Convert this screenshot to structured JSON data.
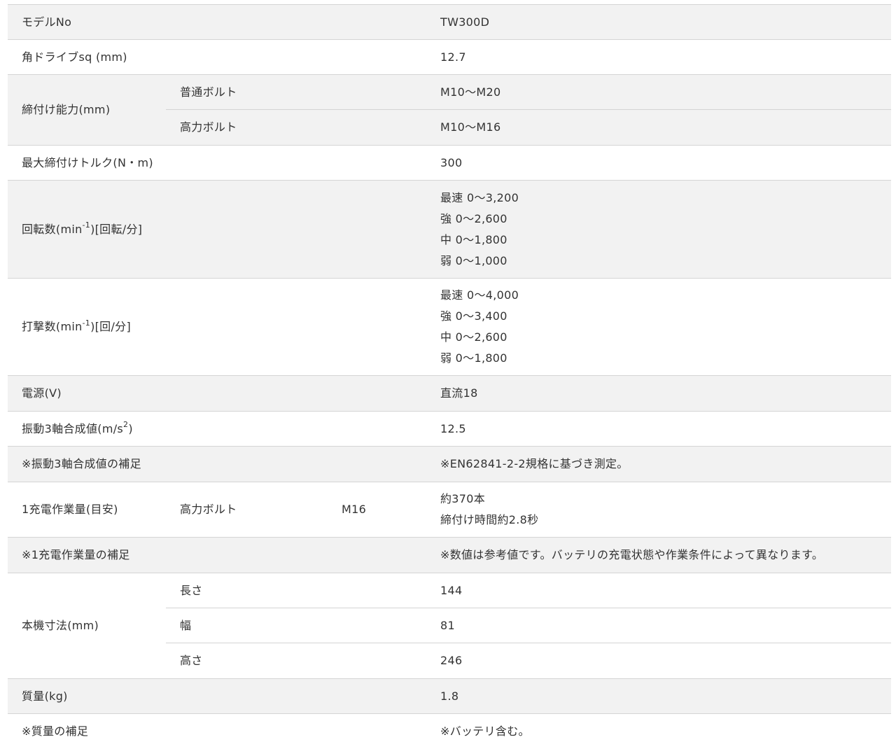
{
  "specs": {
    "model_label": "モデルNo",
    "model_value": "TW300D",
    "square_drive_label": "角ドライブsq (mm)",
    "square_drive_value": "12.7",
    "capacity_label": "締付け能力(mm)",
    "capacity_standard_label": "普通ボルト",
    "capacity_standard_value": "M10〜M20",
    "capacity_high_label": "高力ボルト",
    "capacity_high_value": "M10〜M16",
    "max_torque_label": "最大締付けトルク(N・m)",
    "max_torque_value": "300",
    "rpm_label_pre": "回転数(min",
    "rpm_label_sup": "-1",
    "rpm_label_post": ")[回転/分]",
    "rpm_values": [
      "最速 0〜3,200",
      "強 0〜2,600",
      "中 0〜1,800",
      "弱 0〜1,000"
    ],
    "ipm_label_pre": "打撃数(min",
    "ipm_label_sup": "-1",
    "ipm_label_post": ")[回/分]",
    "ipm_values": [
      "最速 0〜4,000",
      "強 0〜3,400",
      "中 0〜2,600",
      "弱 0〜1,800"
    ],
    "power_label": "電源(V)",
    "power_value": "直流18",
    "vibration_label_pre": "振動3軸合成値(m/s",
    "vibration_label_sup": "2",
    "vibration_label_post": ")",
    "vibration_value": "12.5",
    "vibration_note_label": "※振動3軸合成値の補足",
    "vibration_note_value": "※EN62841-2-2規格に基づき測定。",
    "work_label": "1充電作業量(目安)",
    "work_bolt_label": "高力ボルト",
    "work_bolt_size": "M16",
    "work_values": [
      "約370本",
      "締付け時間約2.8秒"
    ],
    "work_note_label": "※1充電作業量の補足",
    "work_note_value": "※数値は参考値です。バッテリの充電状態や作業条件によって異なります。",
    "dimensions_label": "本機寸法(mm)",
    "length_label": "長さ",
    "length_value": "144",
    "width_label": "幅",
    "width_value": "81",
    "height_label": "高さ",
    "height_value": "246",
    "mass_label": "質量(kg)",
    "mass_value": "1.8",
    "mass_note_label": "※質量の補足",
    "mass_note_value": "※バッテリ含む。"
  }
}
